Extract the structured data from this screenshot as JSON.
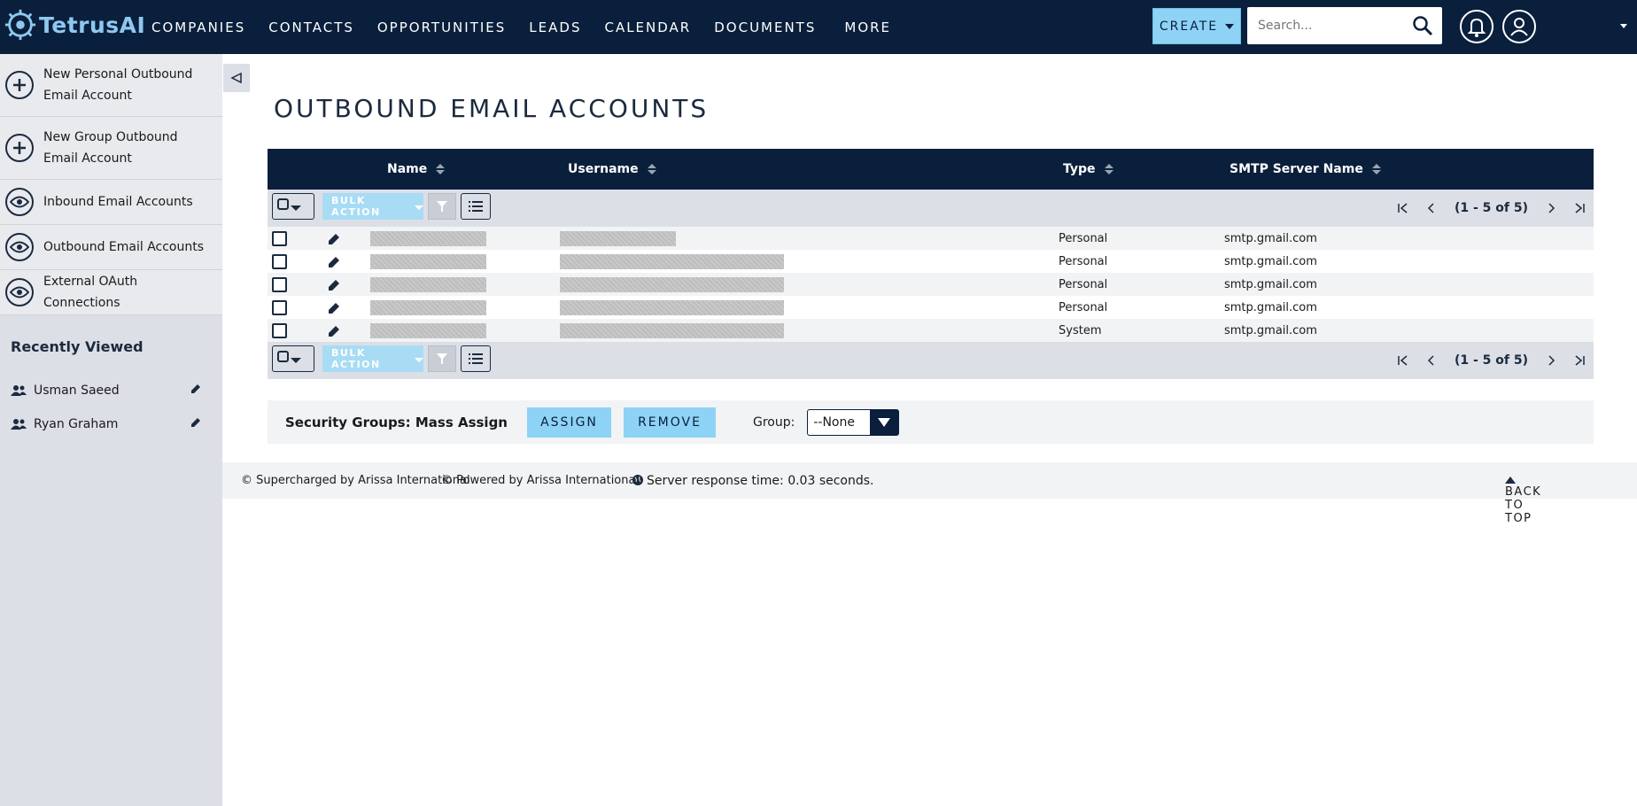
{
  "app": {
    "brand": "TetrusAI"
  },
  "nav": {
    "items": [
      "COMPANIES",
      "CONTACTS",
      "OPPORTUNITIES",
      "LEADS",
      "CALENDAR",
      "DOCUMENTS",
      "MORE"
    ],
    "create_label": "CREATE",
    "search_placeholder": "Search..."
  },
  "sidebar": {
    "actions": [
      {
        "label": "New Personal Outbound Email Account",
        "icon": "plus-circle-icon"
      },
      {
        "label": "New Group Outbound Email Account",
        "icon": "plus-circle-icon"
      },
      {
        "label": "Inbound Email Accounts",
        "icon": "eye-icon"
      },
      {
        "label": "Outbound Email Accounts",
        "icon": "eye-icon"
      },
      {
        "label": "External OAuth Connections",
        "icon": "eye-icon"
      }
    ],
    "recent_title": "Recently Viewed",
    "recent": [
      "Usman Saeed",
      "Ryan Graham"
    ]
  },
  "page": {
    "title": "OUTBOUND EMAIL ACCOUNTS"
  },
  "table": {
    "headers": {
      "name": "Name",
      "username": "Username",
      "type": "Type",
      "smtp": "SMTP Server Name"
    },
    "bulk_label": "BULK ACTION",
    "pagination": "(1 - 5 of 5)",
    "rows": [
      {
        "type": "Personal",
        "smtp": "smtp.gmail.com"
      },
      {
        "type": "Personal",
        "smtp": "smtp.gmail.com"
      },
      {
        "type": "Personal",
        "smtp": "smtp.gmail.com"
      },
      {
        "type": "Personal",
        "smtp": "smtp.gmail.com"
      },
      {
        "type": "System",
        "smtp": "smtp.gmail.com"
      }
    ]
  },
  "mass_assign": {
    "label": "Security Groups: Mass Assign",
    "assign": "ASSIGN",
    "remove": "REMOVE",
    "group_label": "Group:",
    "group_value": "--None"
  },
  "footer": {
    "supercharged": "© Supercharged by Arissa International",
    "powered": "© Powered by Arissa International",
    "server_time": "Server response time: 0.03 seconds.",
    "back_to_top": "BACK TO TOP"
  },
  "colors": {
    "navy": "#0a1f3c",
    "accent": "#8ed3f5",
    "sidebar": "#dcdfe5"
  }
}
